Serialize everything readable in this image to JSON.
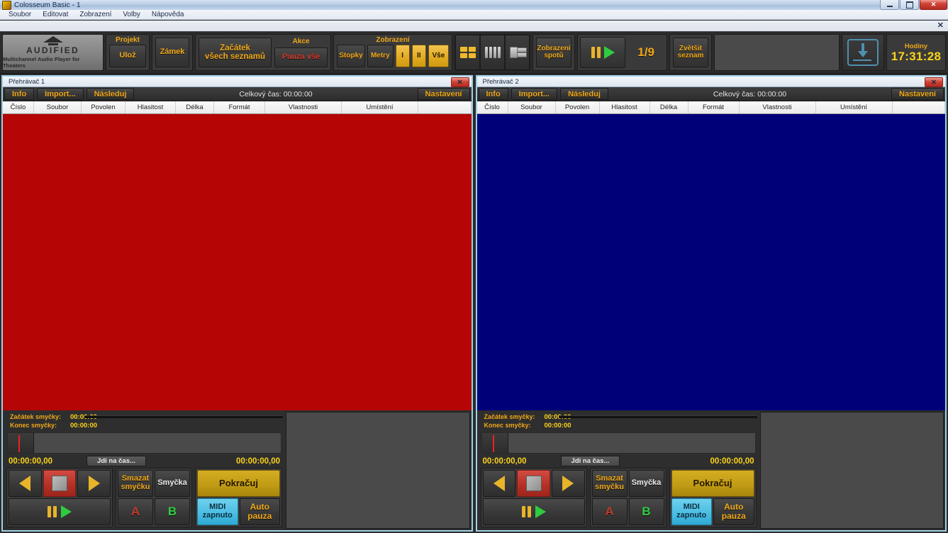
{
  "window": {
    "title": "Colosseum Basic - 1",
    "icon": "app-icon",
    "minimize": "–",
    "maximize": "□",
    "close": "✕"
  },
  "menu": {
    "items": [
      "Soubor",
      "Editovat",
      "Zobrazení",
      "Volby",
      "Nápověda"
    ]
  },
  "mdi": {
    "close": "✕"
  },
  "toolbar": {
    "logo": {
      "word": "AUDIFIED",
      "tagline": "Multichannel Audio Player for Theaters"
    },
    "project": {
      "label": "Projekt",
      "save": "Ulož"
    },
    "lock": "Zámek",
    "start_all": "Začátek\nvšech seznamů",
    "action": {
      "label": "Akce",
      "pause_all": "Pauza vše"
    },
    "view": {
      "label": "Zobrazení",
      "buttons": [
        {
          "label": "Stopky",
          "active": false
        },
        {
          "label": "Metry",
          "active": false
        },
        {
          "label": "I",
          "active": true
        },
        {
          "label": "II",
          "active": true
        },
        {
          "label": "Vše",
          "active": true
        }
      ]
    },
    "layout_icons": [
      {
        "name": "grid-2x2-icon",
        "active": true
      },
      {
        "name": "columns-icon",
        "active": false
      },
      {
        "name": "cascade-icon",
        "active": false
      }
    ],
    "spots_view": "Zobrazení\nspotů",
    "transport": {
      "pause": "pause-icon",
      "play": "play-icon"
    },
    "counter": "1/9",
    "enlarge_list": "Zvětšit\nseznam",
    "download": "download-icon",
    "clock": {
      "label": "Hodiny",
      "time": "17:31:28"
    }
  },
  "columns": [
    "Číslo",
    "Soubor",
    "Povolen",
    "Hlasitost",
    "Délka",
    "Formát",
    "Vlastnosti",
    "Umístění",
    ""
  ],
  "players": [
    {
      "title": "Přehrávač 1",
      "close": "✕",
      "buttons": {
        "info": "Info",
        "import": "Import...",
        "follow": "Následuj",
        "settings": "Nastavení"
      },
      "total_time": "Celkový čas: 00:00:00",
      "list_color": "#b50505",
      "loop": {
        "start_label": "Začátek smyčky:",
        "start_value": "00:00:00",
        "end_label": "Konec smyčky:",
        "end_value": "00:00:00"
      },
      "time_left": "00:00:00,00",
      "time_right": "00:00:00,00",
      "goto": "Jdi na čas...",
      "transport": {
        "prev": "previous-track-icon",
        "stop": "stop-icon",
        "next": "next-track-icon",
        "pause": "pause-icon",
        "play": "play-icon"
      },
      "loop_controls": {
        "clear_loop": "Smazat\nsmyčku",
        "loop": "Smyčka",
        "a": "A",
        "b": "B"
      },
      "right_controls": {
        "continue": "Pokračuj",
        "midi": "MIDI\nzapnuto",
        "auto_pause": "Auto\npauza"
      }
    },
    {
      "title": "Přehrávač 2",
      "close": "✕",
      "buttons": {
        "info": "Info",
        "import": "Import...",
        "follow": "Následuj",
        "settings": "Nastavení"
      },
      "total_time": "Celkový čas: 00:00:00",
      "list_color": "#000079",
      "loop": {
        "start_label": "Začátek smyčky:",
        "start_value": "00:00:00",
        "end_label": "Konec smyčky:",
        "end_value": "00:00:00"
      },
      "time_left": "00:00:00,00",
      "time_right": "00:00:00,00",
      "goto": "Jdi na čas...",
      "transport": {
        "prev": "previous-track-icon",
        "stop": "stop-icon",
        "next": "next-track-icon",
        "pause": "pause-icon",
        "play": "play-icon"
      },
      "loop_controls": {
        "clear_loop": "Smazat\nsmyčku",
        "loop": "Smyčka",
        "a": "A",
        "b": "B"
      },
      "right_controls": {
        "continue": "Pokračuj",
        "midi": "MIDI\nzapnuto",
        "auto_pause": "Auto\npauza"
      }
    }
  ],
  "colors": {
    "accent": "#f0a818",
    "clock": "#fbd31c",
    "player1": "#b50505",
    "player2": "#000079",
    "midi": "#49bce2",
    "stop": "#b63127"
  }
}
